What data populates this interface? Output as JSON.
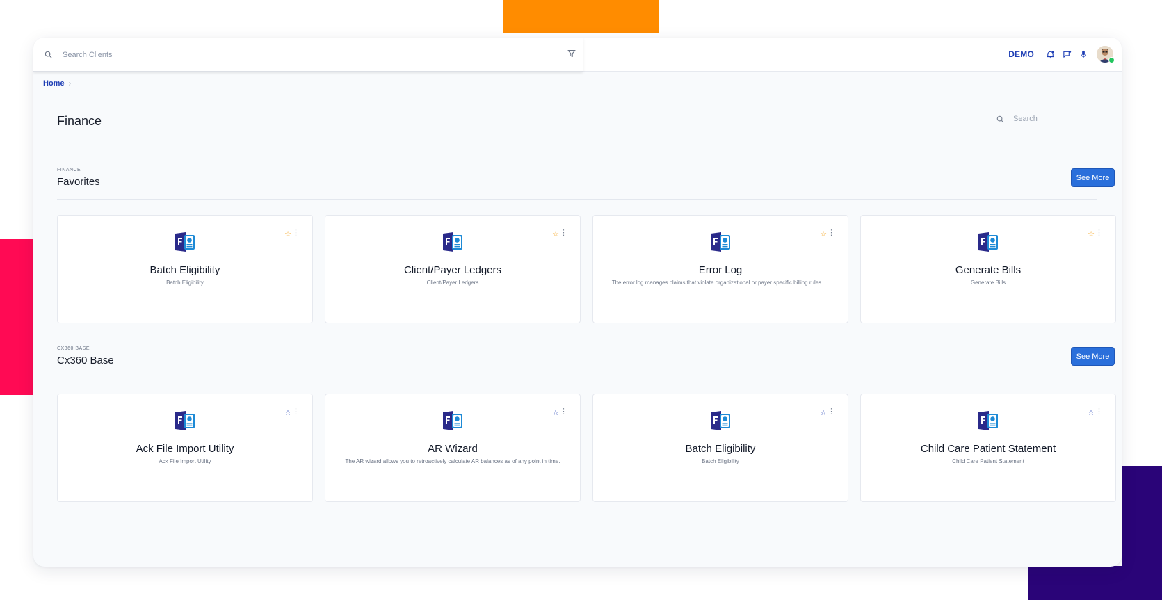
{
  "colors": {
    "accent": "#2a6fdb",
    "brand_blue": "#1f3fb5",
    "star_favorite": "#f5a623",
    "star_base": "#1f3fb5",
    "deco_orange": "#ff8c00",
    "deco_pink": "#ff0a54",
    "deco_purple": "#2a0478"
  },
  "topbar": {
    "search_placeholder": "Search Clients",
    "demo_label": "DEMO",
    "icons": [
      "search-icon",
      "filter-icon",
      "bell-icon",
      "chat-icon",
      "microphone-icon",
      "avatar"
    ]
  },
  "breadcrumb": {
    "home": "Home"
  },
  "page": {
    "title": "Finance",
    "search_placeholder": "Search"
  },
  "sections": [
    {
      "kicker": "FINANCE",
      "title": "Favorites",
      "see_more": "See More",
      "cards": [
        {
          "title": "Batch Eligibility",
          "subtitle": "Batch Eligibility"
        },
        {
          "title": "Client/Payer Ledgers",
          "subtitle": "Client/Payer Ledgers"
        },
        {
          "title": "Error Log",
          "subtitle": "The error log manages claims that violate organizational or payer specific billing rules. ..."
        },
        {
          "title": "Generate Bills",
          "subtitle": "Generate Bills"
        }
      ]
    },
    {
      "kicker": "CX360 BASE",
      "title": "Cx360 Base",
      "see_more": "See More",
      "cards": [
        {
          "title": "Ack File Import Utility",
          "subtitle": "Ack File Import Utility"
        },
        {
          "title": "AR Wizard",
          "subtitle": "The AR wizard allows you to retroactively calculate AR balances as of any point in time."
        },
        {
          "title": "Batch Eligibility",
          "subtitle": "Batch Eligibility"
        },
        {
          "title": "Child Care Patient Statement",
          "subtitle": "Child Care Patient Statement"
        }
      ]
    }
  ]
}
